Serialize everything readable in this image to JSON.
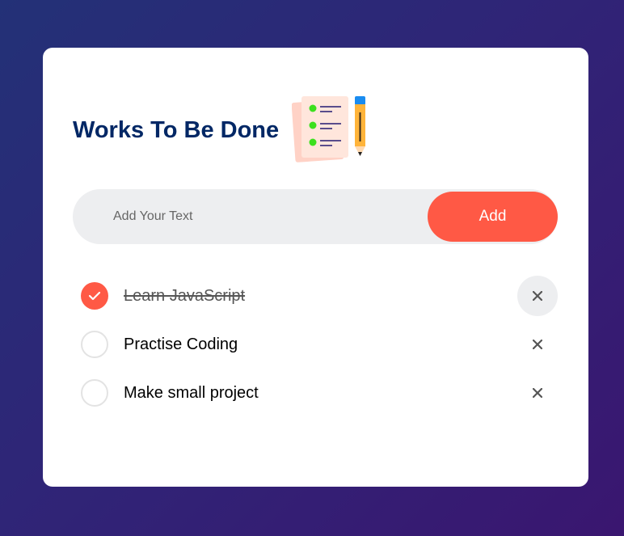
{
  "header": {
    "title": "Works To Be Done",
    "icon": "checklist-with-pencil-icon"
  },
  "input": {
    "placeholder": "Add Your Text",
    "value": ""
  },
  "add_button": {
    "label": "Add"
  },
  "tasks": [
    {
      "text": "Learn JavaScript",
      "checked": true
    },
    {
      "text": "Practise Coding",
      "checked": false
    },
    {
      "text": "Make small project",
      "checked": false
    }
  ],
  "colors": {
    "accent": "#ff5945",
    "title": "#002765",
    "input_bg": "#edeef0",
    "background_start": "#233177",
    "background_end": "#3a1670"
  }
}
